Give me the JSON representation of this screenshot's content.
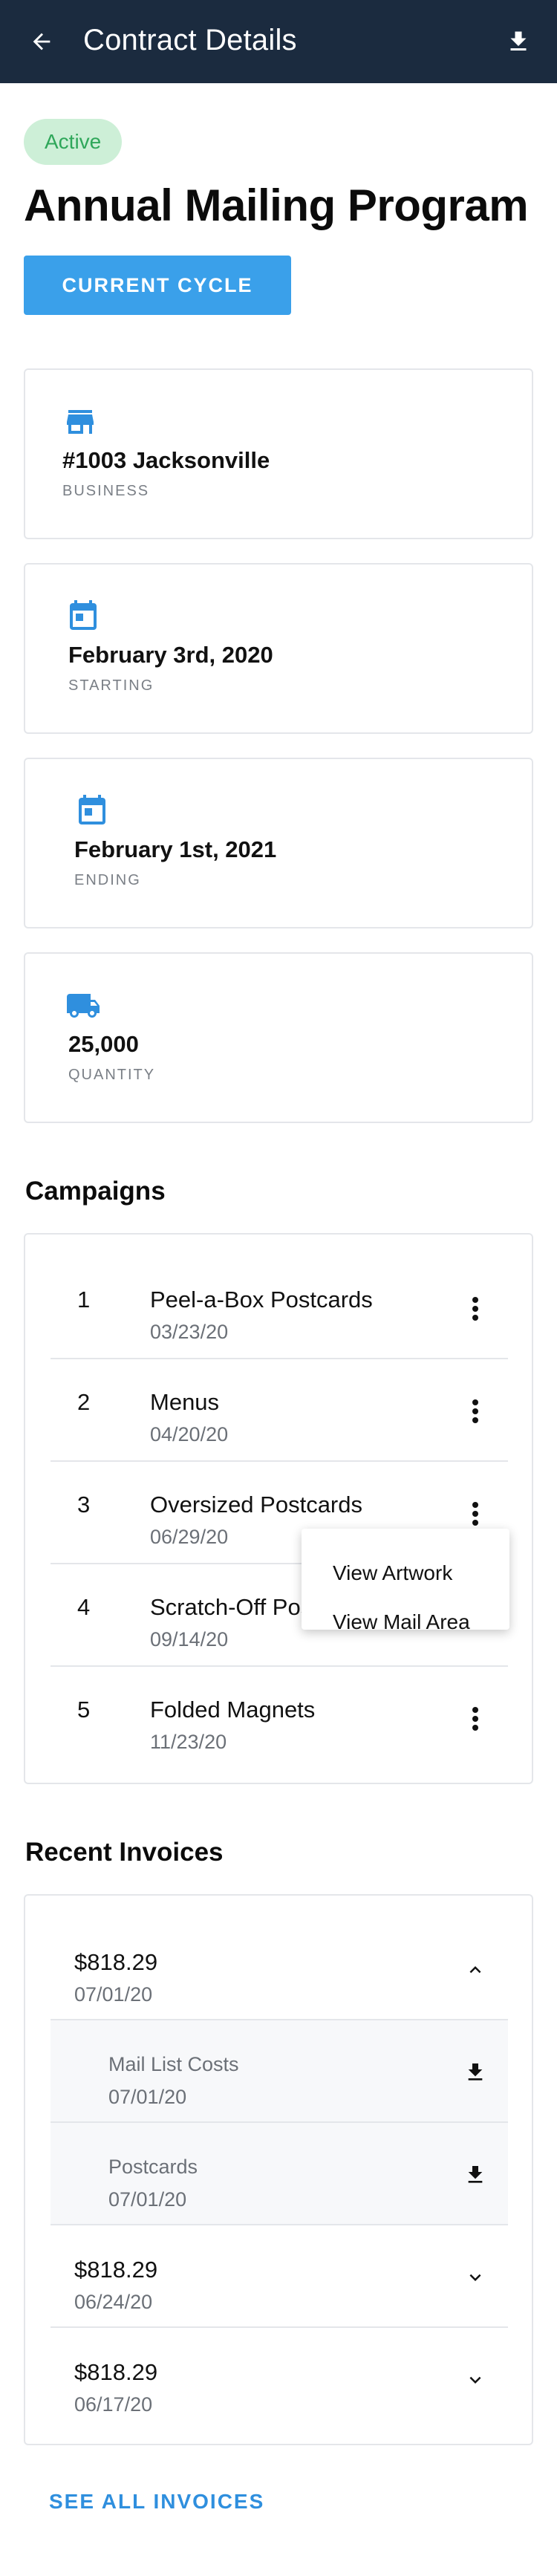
{
  "appbar": {
    "title": "Contract Details",
    "back_icon": "arrow-left-icon",
    "download_icon": "download-icon"
  },
  "contract": {
    "status": "Active",
    "title": "Annual Mailing Program",
    "cycle_button": "CURRENT CYCLE"
  },
  "info_cards": [
    {
      "icon": "store-icon",
      "value": "#1003 Jacksonville",
      "label": "BUSINESS"
    },
    {
      "icon": "calendar-icon",
      "value": "February 3rd, 2020",
      "label": "STARTING"
    },
    {
      "icon": "calendar-icon",
      "value": "February 1st, 2021",
      "label": "ENDING"
    },
    {
      "icon": "truck-icon",
      "value": "25,000",
      "label": "QUANTITY"
    }
  ],
  "campaigns": {
    "title": "Campaigns",
    "items": [
      {
        "num": "1",
        "name": "Peel-a-Box Postcards",
        "date": "03/23/20"
      },
      {
        "num": "2",
        "name": "Menus",
        "date": "04/20/20"
      },
      {
        "num": "3",
        "name": "Oversized Postcards",
        "date": "06/29/20"
      },
      {
        "num": "4",
        "name": "Scratch-Off Postcards",
        "date": "09/14/20"
      },
      {
        "num": "5",
        "name": "Folded Magnets",
        "date": "11/23/20"
      }
    ],
    "menu": {
      "items": [
        "View Artwork",
        "View Mail Area"
      ]
    }
  },
  "invoices": {
    "title": "Recent Invoices",
    "first": {
      "amount": "$818.29",
      "date": "07/01/20"
    },
    "sub_items": [
      {
        "name": "Mail List Costs",
        "date": "07/01/20"
      },
      {
        "name": "Postcards",
        "date": "07/01/20"
      }
    ],
    "others": [
      {
        "amount": "$818.29",
        "date": "06/24/20"
      },
      {
        "amount": "$818.29",
        "date": "06/17/20"
      }
    ],
    "see_all": "SEE ALL INVOICES"
  },
  "colors": {
    "appbar": "#1b2b3f",
    "accent": "#3aa0ea",
    "active_badge_bg": "#cdefd7",
    "active_badge_text": "#2fa75a"
  }
}
